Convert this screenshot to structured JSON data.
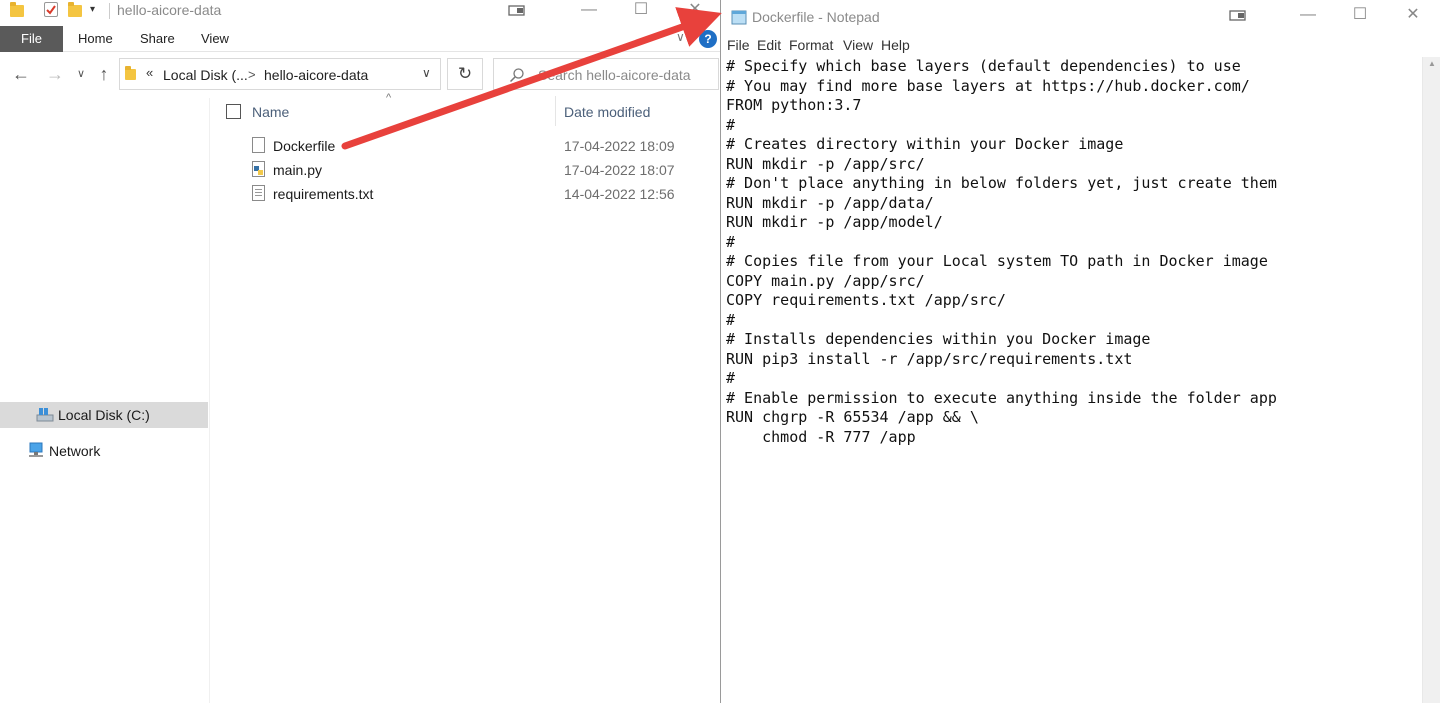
{
  "explorer": {
    "title": "hello-aicore-data",
    "ribbon_tabs": {
      "file": "File",
      "home": "Home",
      "share": "Share",
      "view": "View"
    },
    "address": {
      "chevron": "«",
      "segment_1": "Local Disk (...",
      "separator": ">",
      "segment_2": "hello-aicore-data"
    },
    "search_placeholder": "Search hello-aicore-data",
    "nav_items": {
      "local_disk": "Local Disk (C:)",
      "network": "Network"
    },
    "columns": {
      "name": "Name",
      "date_modified": "Date modified"
    },
    "files": [
      {
        "name": "Dockerfile",
        "date": "17-04-2022 18:09",
        "icon": "document-icon"
      },
      {
        "name": "main.py",
        "date": "17-04-2022 18:07",
        "icon": "python-file-icon"
      },
      {
        "name": "requirements.txt",
        "date": "14-04-2022 12:56",
        "icon": "text-file-icon"
      }
    ]
  },
  "notepad": {
    "title": "Dockerfile - Notepad",
    "menu": {
      "file": "File",
      "edit": "Edit",
      "format": "Format",
      "view": "View",
      "help": "Help"
    },
    "lines": [
      "# Specify which base layers (default dependencies) to use",
      "# You may find more base layers at https://hub.docker.com/",
      "FROM python:3.7",
      "#",
      "# Creates directory within your Docker image",
      "RUN mkdir -p /app/src/",
      "# Don't place anything in below folders yet, just create them",
      "RUN mkdir -p /app/data/",
      "RUN mkdir -p /app/model/",
      "#",
      "# Copies file from your Local system TO path in Docker image",
      "COPY main.py /app/src/",
      "COPY requirements.txt /app/src/",
      "#",
      "# Installs dependencies within you Docker image",
      "RUN pip3 install -r /app/src/requirements.txt",
      "#",
      "# Enable permission to execute anything inside the folder app",
      "RUN chgrp -R 65534 /app && \\",
      "    chmod -R 777 /app"
    ]
  },
  "colors": {
    "arrow": "#e8413c",
    "file_tab": "#5a5a5a",
    "selected_nav": "#dadada",
    "help_icon": "#1f6fc5"
  }
}
